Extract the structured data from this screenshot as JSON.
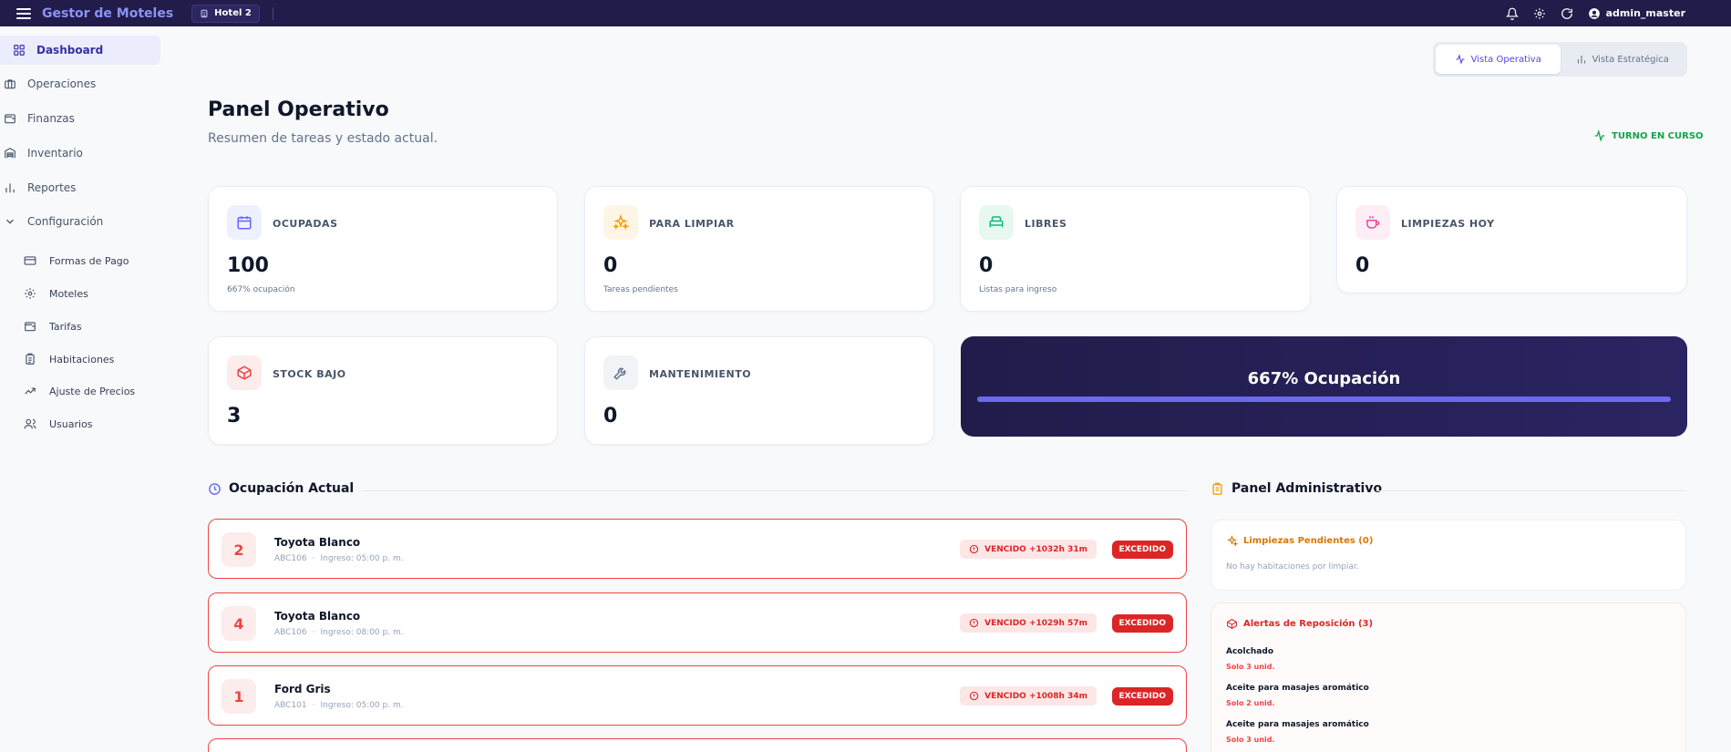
{
  "app": {
    "title": "Gestor de Moteles",
    "hotel": "Hotel 2",
    "user": "admin_master"
  },
  "colors": {
    "navbar": "#211c4a",
    "accent": "#4f46e5",
    "danger": "#dc2626",
    "success": "#16a34a"
  },
  "sidebar": {
    "items": [
      {
        "label": "Dashboard",
        "icon": "grid-icon",
        "active": true
      },
      {
        "label": "Operaciones",
        "icon": "briefcase-icon"
      },
      {
        "label": "Finanzas",
        "icon": "wallet-icon"
      },
      {
        "label": "Inventario",
        "icon": "warehouse-icon"
      },
      {
        "label": "Reportes",
        "icon": "bar-chart-icon"
      },
      {
        "label": "Configuración",
        "icon": "chevron-down-icon"
      }
    ],
    "sub_items": [
      {
        "label": "Formas de Pago",
        "icon": "credit-card-icon"
      },
      {
        "label": "Moteles",
        "icon": "gear-icon"
      },
      {
        "label": "Tarifas",
        "icon": "wallet-icon"
      },
      {
        "label": "Habitaciones",
        "icon": "clipboard-icon"
      },
      {
        "label": "Ajuste de Precios",
        "icon": "trending-up-icon"
      },
      {
        "label": "Usuarios",
        "icon": "users-icon"
      }
    ]
  },
  "view_toggle": {
    "operativa": "Vista Operativa",
    "estrategica": "Vista Estratégica"
  },
  "header": {
    "title": "Panel Operativo",
    "subtitle": "Resumen de tareas y estado actual.",
    "shift_status": "TURNO EN CURSO"
  },
  "stats": [
    {
      "label": "OCUPADAS",
      "value": "100",
      "sub": "667% ocupación",
      "icon": "calendar-icon",
      "color": "#6366f1"
    },
    {
      "label": "PARA LIMPIAR",
      "value": "0",
      "sub": "Tareas pendientes",
      "icon": "sparkles-icon",
      "color": "#f59e0b"
    },
    {
      "label": "LIBRES",
      "value": "0",
      "sub": "Listas para ingreso",
      "icon": "bed-icon",
      "color": "#10b981"
    },
    {
      "label": "LIMPIEZAS HOY",
      "value": "0",
      "sub": "",
      "icon": "cup-icon",
      "color": "#ec4899"
    },
    {
      "label": "STOCK BAJO",
      "value": "3",
      "sub": "",
      "icon": "package-icon",
      "color": "#ef4444"
    },
    {
      "label": "MANTENIMIENTO",
      "value": "0",
      "sub": "",
      "icon": "wrench-icon",
      "color": "#64748b"
    }
  ],
  "occupancy": {
    "label": "667% Ocupación",
    "progress": 1.0
  },
  "current": {
    "title": "Ocupación Actual",
    "rows": [
      {
        "room": "2",
        "vehicle": "Toyota Blanco",
        "plate": "ABC106",
        "checkin": "Ingreso: 05:00 p. m.",
        "overdue": "VENCIDO +1032h 31m",
        "badge": "EXCEDIDO"
      },
      {
        "room": "4",
        "vehicle": "Toyota Blanco",
        "plate": "ABC106",
        "checkin": "Ingreso: 08:00 p. m.",
        "overdue": "VENCIDO +1029h 57m",
        "badge": "EXCEDIDO"
      },
      {
        "room": "1",
        "vehicle": "Ford Gris",
        "plate": "ABC101",
        "checkin": "Ingreso: 05:00 p. m.",
        "overdue": "VENCIDO +1008h 34m",
        "badge": "EXCEDIDO"
      }
    ]
  },
  "admin": {
    "title": "Panel Administrativo",
    "cleanings": {
      "title": "Limpiezas Pendientes (0)",
      "empty": "No hay habitaciones por limpiar."
    },
    "alerts": {
      "title": "Alertas de Reposición (3)",
      "items": [
        {
          "name": "Acolchado",
          "qty": "Solo 3 unid."
        },
        {
          "name": "Aceite para masajes aromático",
          "qty": "Solo 2 unid."
        },
        {
          "name": "Aceite para masajes aromático",
          "qty": "Solo 3 unid."
        }
      ]
    }
  }
}
